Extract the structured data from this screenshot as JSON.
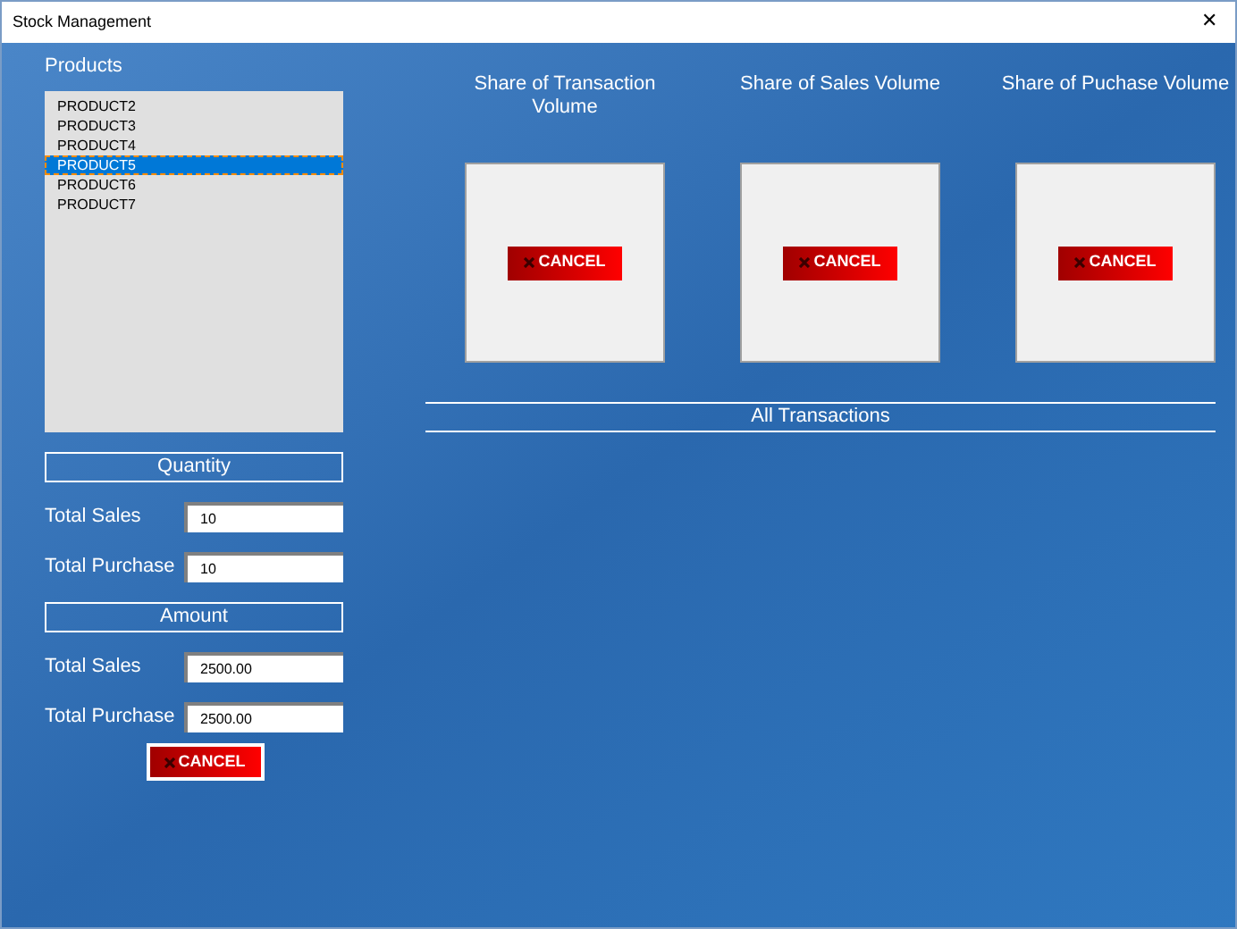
{
  "window": {
    "title": "Stock Management",
    "close": "✕"
  },
  "products": {
    "title": "Products",
    "items": [
      {
        "label": "PRODUCT2",
        "selected": false
      },
      {
        "label": "PRODUCT3",
        "selected": false
      },
      {
        "label": "PRODUCT4",
        "selected": false
      },
      {
        "label": "PRODUCT5",
        "selected": true
      },
      {
        "label": "PRODUCT6",
        "selected": false
      },
      {
        "label": "PRODUCT7",
        "selected": false
      }
    ]
  },
  "quantity": {
    "title": "Quantity",
    "fields": [
      {
        "label": "Total Sales",
        "value": "10"
      },
      {
        "label": "Total Purchase",
        "value": "10"
      }
    ]
  },
  "amount": {
    "title": "Amount",
    "fields": [
      {
        "label": "Total Sales",
        "value": "2500.00"
      },
      {
        "label": "Total Purchase",
        "value": "2500.00"
      }
    ]
  },
  "cancel_button": "CANCEL",
  "charts": [
    {
      "title": "Share of Transaction Volume",
      "button": "CANCEL"
    },
    {
      "title": "Share of Sales Volume",
      "button": "CANCEL"
    },
    {
      "title": "Share of Puchase Volume",
      "button": "CANCEL"
    }
  ],
  "all_transactions": "All Transactions"
}
